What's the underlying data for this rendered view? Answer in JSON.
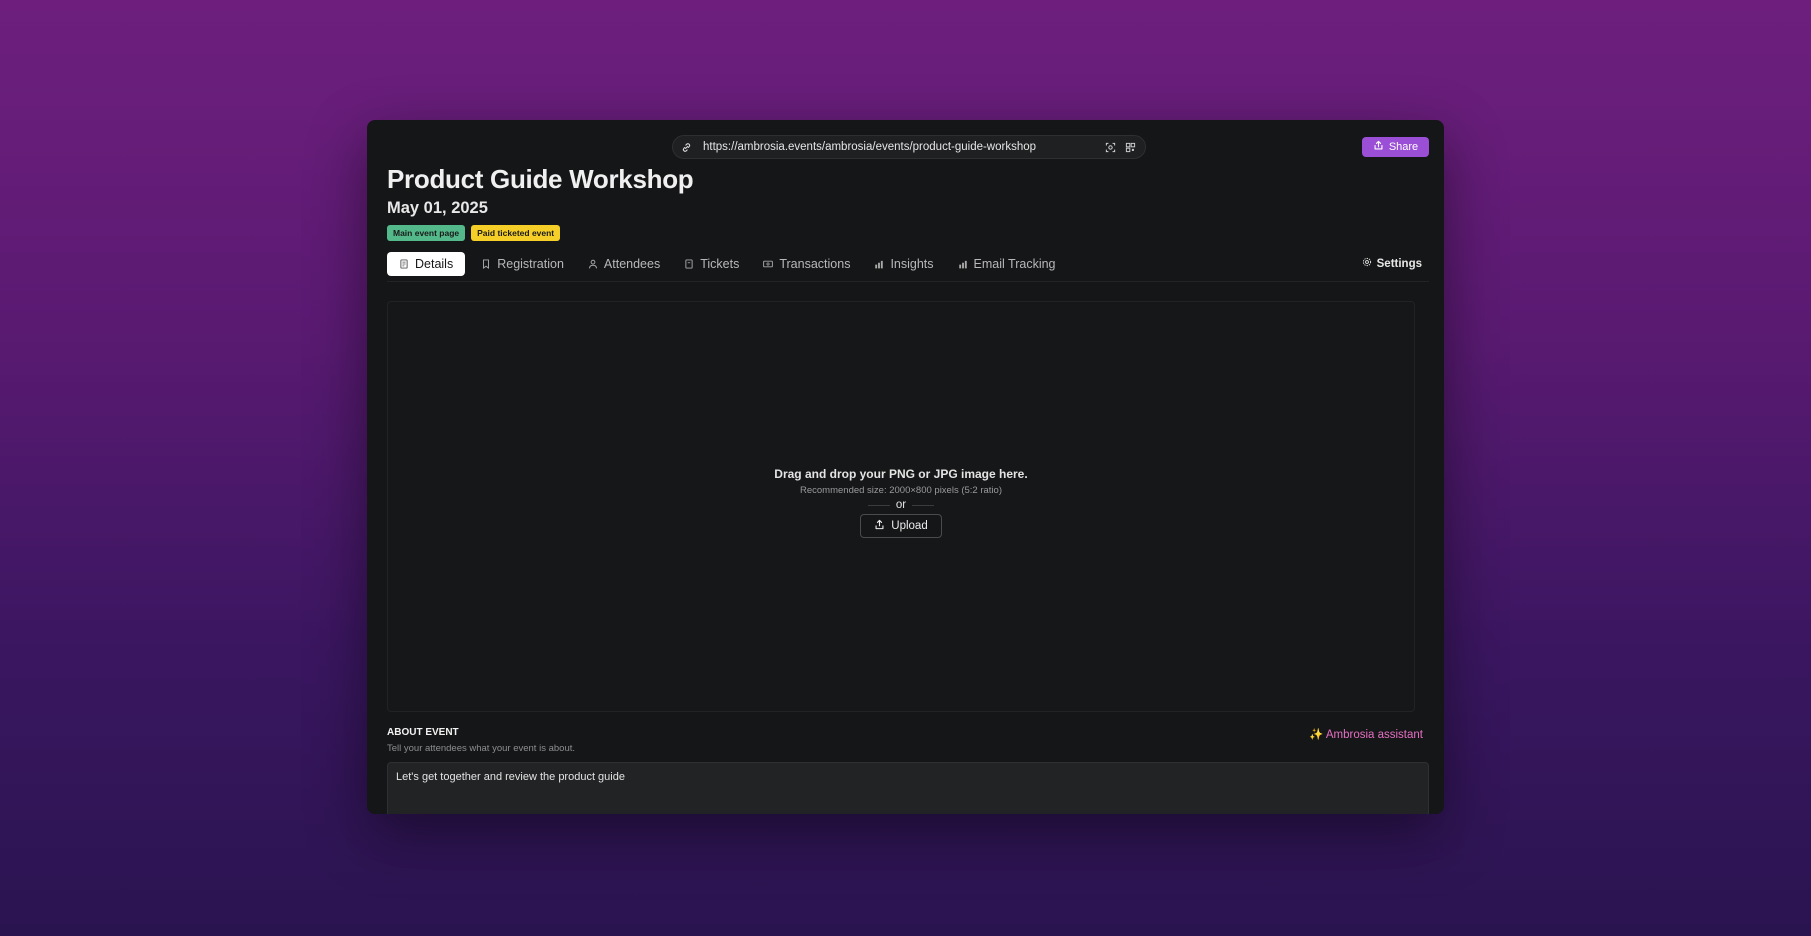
{
  "url_bar": {
    "url": "https://ambrosia.events/ambrosia/events/product-guide-workshop"
  },
  "share_label": "Share",
  "event": {
    "title": "Product Guide Workshop",
    "date": "May 01, 2025",
    "badges": [
      "Main event page",
      "Paid ticketed event"
    ]
  },
  "tabs": [
    {
      "label": "Details",
      "icon": "document-icon",
      "active": true
    },
    {
      "label": "Registration",
      "icon": "bookmark-icon"
    },
    {
      "label": "Attendees",
      "icon": "person-icon"
    },
    {
      "label": "Tickets",
      "icon": "ticket-icon"
    },
    {
      "label": "Transactions",
      "icon": "money-icon"
    },
    {
      "label": "Insights",
      "icon": "bar-chart-icon"
    },
    {
      "label": "Email Tracking",
      "icon": "bar-chart-icon"
    }
  ],
  "settings_label": "Settings",
  "dropzone": {
    "title": "Drag and drop your PNG or JPG image here.",
    "subtitle": "Recommended size: 2000×800 pixels (5:2 ratio)",
    "or_label": "or",
    "upload_label": "Upload"
  },
  "about": {
    "heading": "ABOUT EVENT",
    "subheading": "Tell your attendees what your event is about.",
    "assistant_label": "Ambrosia assistant",
    "text": "Let's get together and review the product guide"
  },
  "colors": {
    "accent": "#9b4fd6",
    "badge_green": "#54b98a",
    "badge_yellow": "#f5cf28",
    "assistant_pink": "#e56fc2"
  }
}
